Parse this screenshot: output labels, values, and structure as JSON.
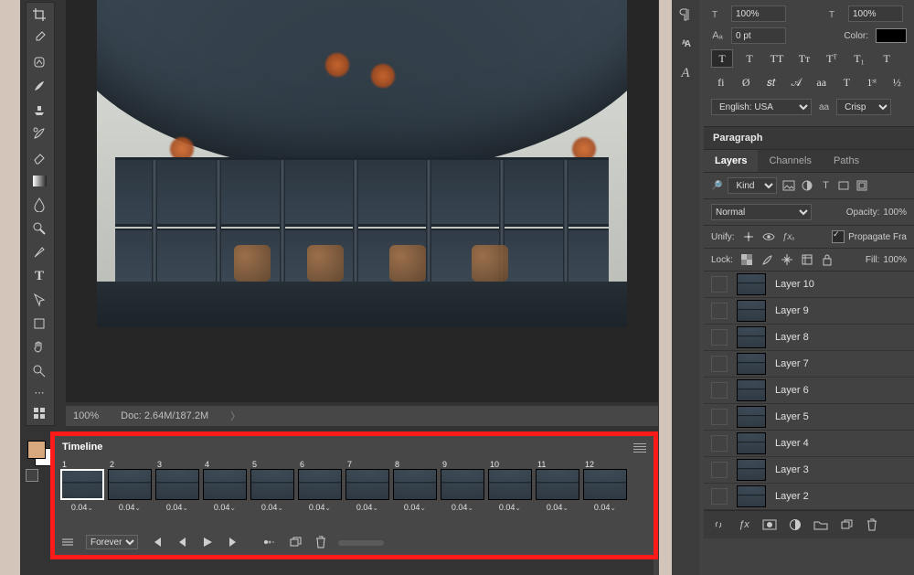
{
  "canvas": {
    "zoom": "100%",
    "doc_size": "Doc: 2.64M/187.2M"
  },
  "char": {
    "size": "100%",
    "size2": "100%",
    "leading_value": "0 pt",
    "color_label": "Color:",
    "language": "English: USA",
    "aa_label": "aa",
    "aa_mode": "Crisp",
    "fmt_buttons": [
      "T",
      "T",
      "TT",
      "Tᴛ",
      "Tᵀ",
      "T₁",
      "T",
      "fi",
      "Ø",
      "𝑠𝑡",
      "𝒜",
      "aa",
      "T",
      "1ˢᵗ",
      "½"
    ]
  },
  "paragraph": {
    "title": "Paragraph"
  },
  "layers_panel": {
    "tabs": [
      "Layers",
      "Channels",
      "Paths"
    ],
    "filter_label": "Kind",
    "blend_mode": "Normal",
    "opacity_label": "Opacity:",
    "opacity_value": "100%",
    "unify_label": "Unify:",
    "propagate_label": "Propagate Fra",
    "lock_label": "Lock:",
    "fill_label": "Fill:",
    "fill_value": "100%"
  },
  "layers": [
    {
      "name": "Layer 10"
    },
    {
      "name": "Layer 9"
    },
    {
      "name": "Layer 8"
    },
    {
      "name": "Layer 7"
    },
    {
      "name": "Layer 6"
    },
    {
      "name": "Layer 5"
    },
    {
      "name": "Layer 4"
    },
    {
      "name": "Layer 3"
    },
    {
      "name": "Layer 2"
    }
  ],
  "timeline": {
    "title": "Timeline",
    "loop": "Forever",
    "frames": [
      {
        "n": "1",
        "d": "0.04"
      },
      {
        "n": "2",
        "d": "0.04"
      },
      {
        "n": "3",
        "d": "0.04"
      },
      {
        "n": "4",
        "d": "0.04"
      },
      {
        "n": "5",
        "d": "0.04"
      },
      {
        "n": "6",
        "d": "0.04"
      },
      {
        "n": "7",
        "d": "0.04"
      },
      {
        "n": "8",
        "d": "0.04"
      },
      {
        "n": "9",
        "d": "0.04"
      },
      {
        "n": "10",
        "d": "0.04"
      },
      {
        "n": "11",
        "d": "0.04"
      },
      {
        "n": "12",
        "d": "0.04"
      }
    ]
  }
}
